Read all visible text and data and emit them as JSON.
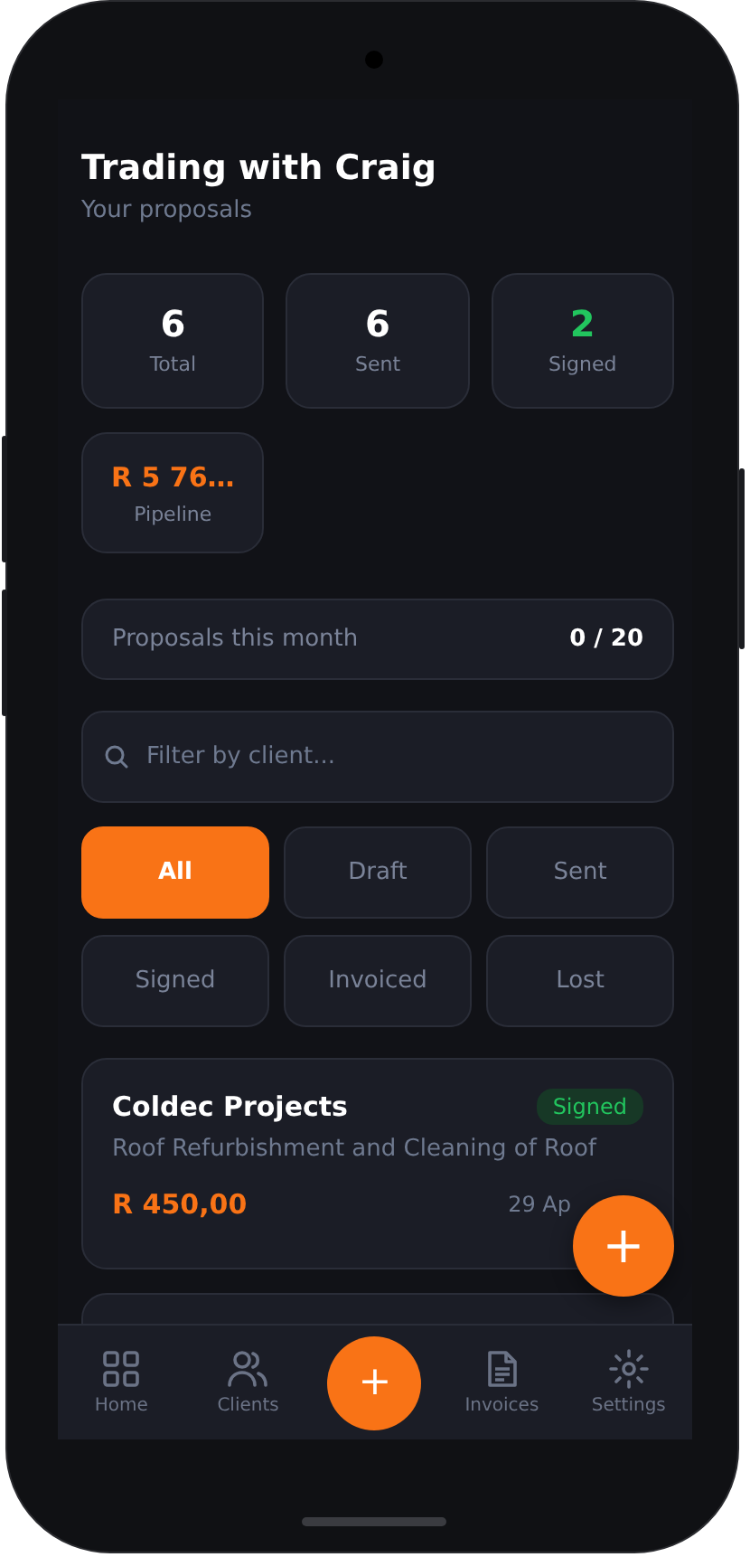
{
  "app": {
    "title": "Trading with Craig",
    "subtitle": "Your proposals"
  },
  "stats": [
    {
      "value": "6",
      "label": "Total",
      "kind": "plain"
    },
    {
      "value": "6",
      "label": "Sent",
      "kind": "plain"
    },
    {
      "value": "2",
      "label": "Signed",
      "kind": "success"
    },
    {
      "value": "R 5 76…",
      "label": "Pipeline",
      "kind": "money"
    }
  ],
  "quota": {
    "label": "Proposals this month",
    "value": "0 / 20"
  },
  "search": {
    "placeholder": "Filter by client..."
  },
  "filters": [
    {
      "label": "All",
      "selected": true
    },
    {
      "label": "Draft",
      "selected": false
    },
    {
      "label": "Sent",
      "selected": false
    },
    {
      "label": "Signed",
      "selected": false
    },
    {
      "label": "Invoiced",
      "selected": false
    },
    {
      "label": "Lost",
      "selected": false
    }
  ],
  "proposals": [
    {
      "client": "Coldec Projects",
      "status": "Signed",
      "kind": "signed",
      "description": "Roof Refurbishment and Cleaning of Roof",
      "amount": "R 450,00",
      "date": "29 Ap"
    }
  ],
  "fab": {
    "label": "+"
  },
  "nav": [
    {
      "kind": "tab",
      "label": "Home"
    },
    {
      "kind": "tab",
      "label": "Clients"
    },
    {
      "kind": "add",
      "label": "+"
    },
    {
      "kind": "tab",
      "label": "Invoices"
    },
    {
      "kind": "tab",
      "label": "Settings"
    }
  ]
}
